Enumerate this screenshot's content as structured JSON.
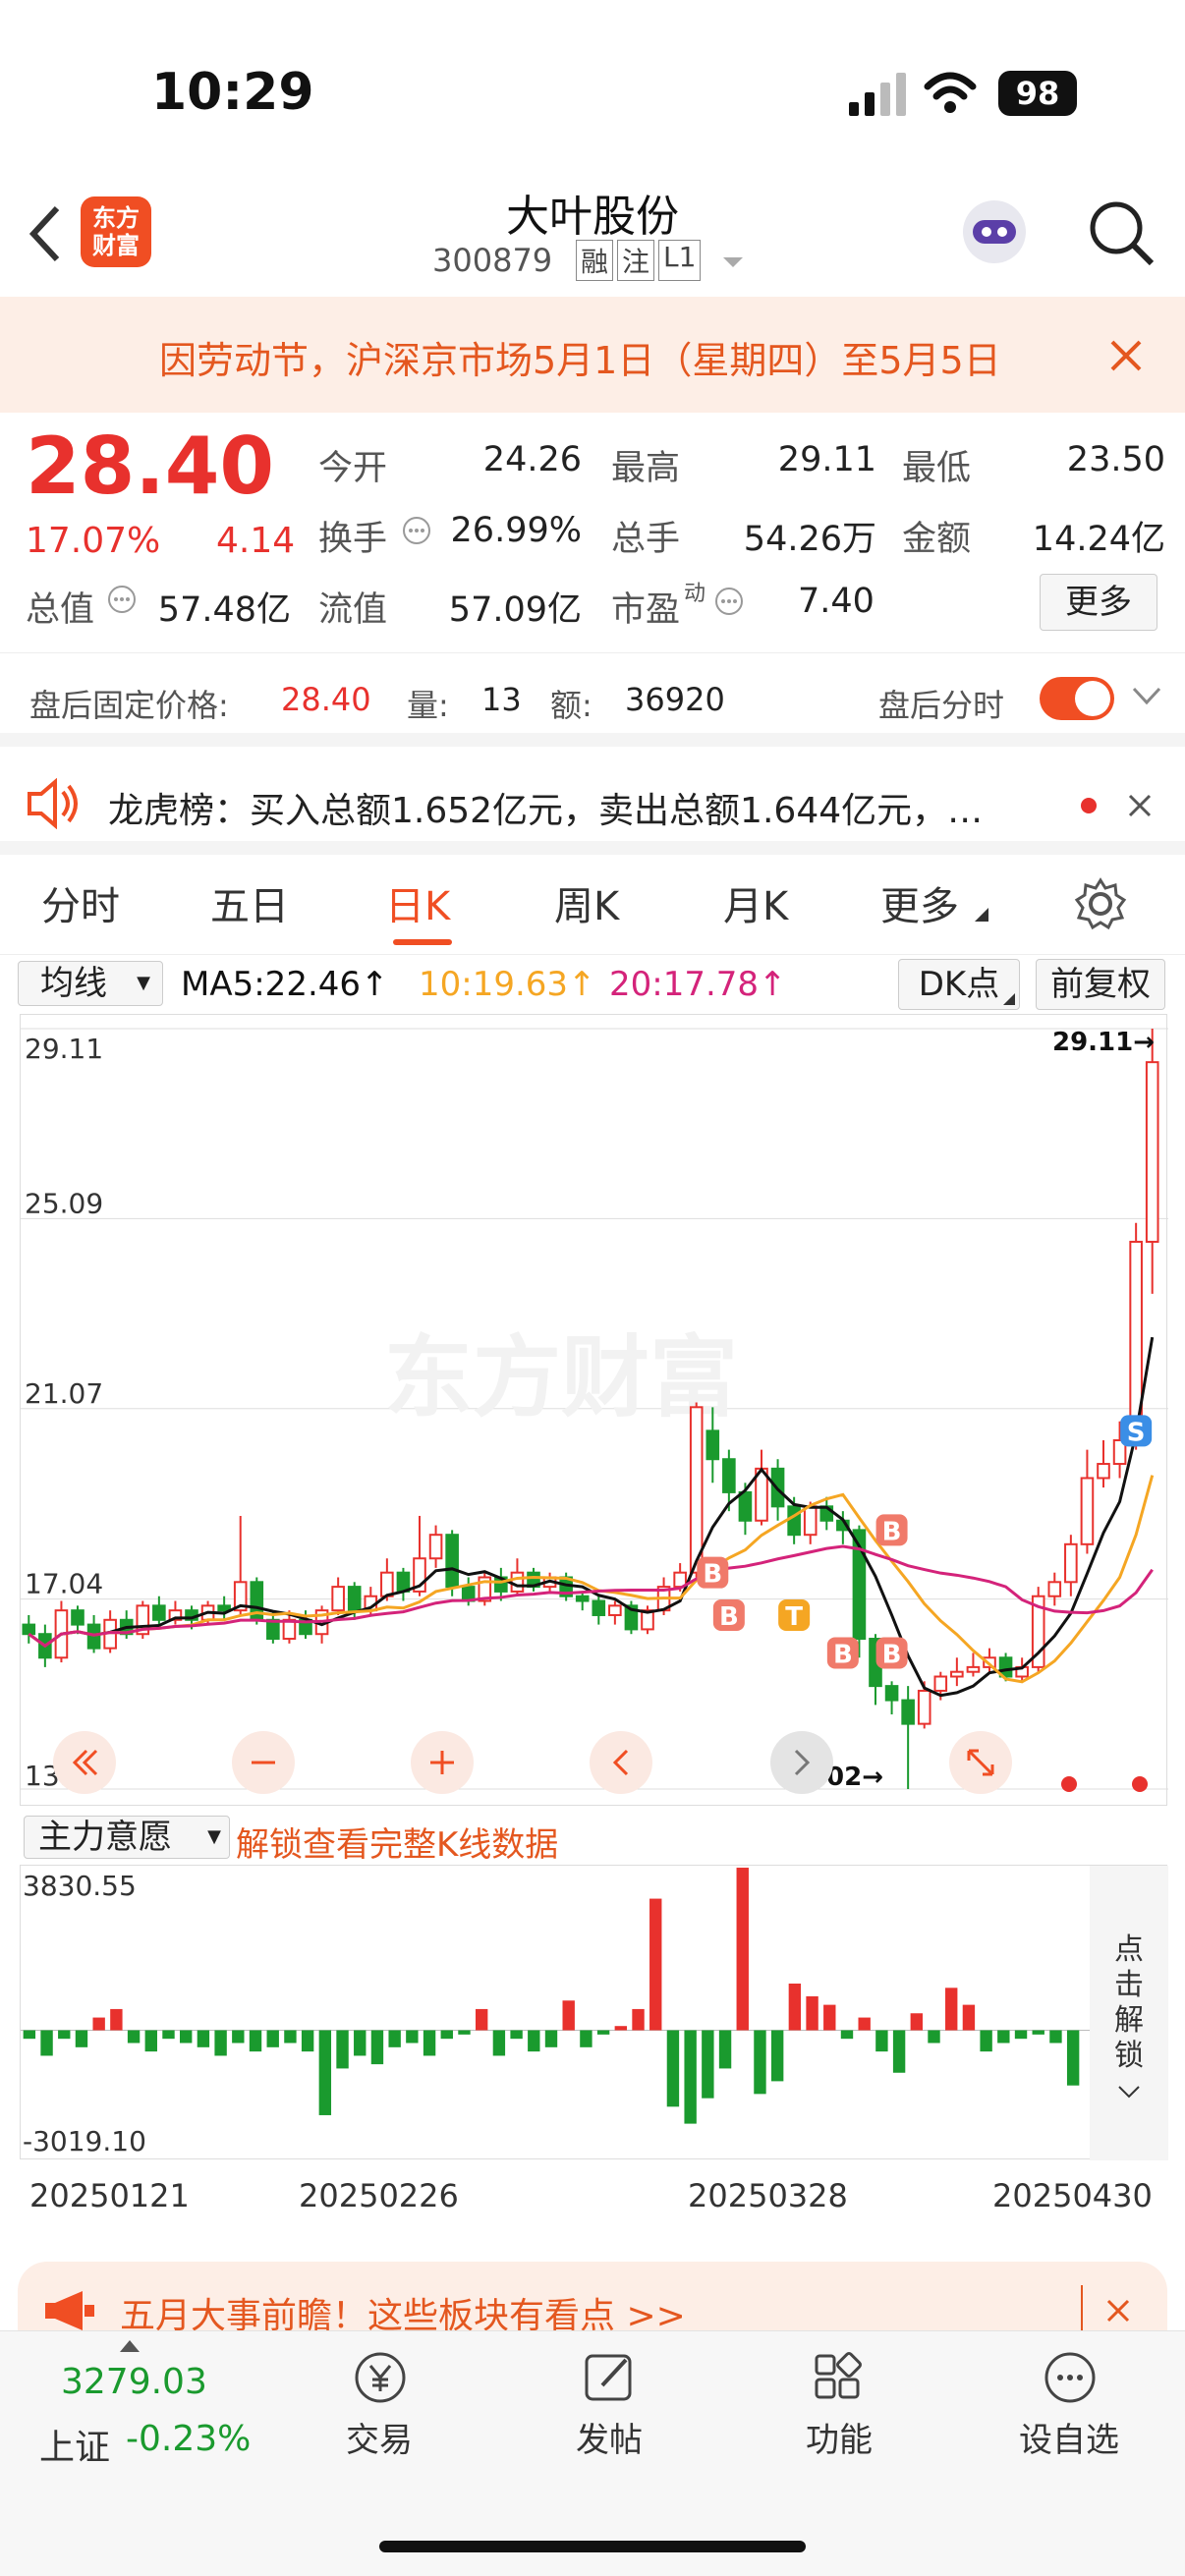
{
  "status": {
    "time": "10:29",
    "battery": "98"
  },
  "header": {
    "logo_line1": "东方",
    "logo_line2": "财富",
    "title": "大叶股份",
    "code": "300879",
    "tags": [
      "融",
      "注",
      "L1"
    ]
  },
  "notice": {
    "text": "因劳动节，沪深京市场5月1日（星期四）至5月5日"
  },
  "quote": {
    "price": "28.40",
    "change_pct": "17.07%",
    "change": "4.14",
    "fields": [
      {
        "label": "今开",
        "value": "24.26"
      },
      {
        "label": "最高",
        "value": "29.11"
      },
      {
        "label": "最低",
        "value": "23.50"
      },
      {
        "label": "换手",
        "value": "26.99%"
      },
      {
        "label": "总手",
        "value": "54.26万"
      },
      {
        "label": "金额",
        "value": "14.24亿"
      },
      {
        "label": "总值",
        "value": "57.48亿"
      },
      {
        "label": "流值",
        "value": "57.09亿"
      },
      {
        "label": "市盈",
        "value": "7.40"
      }
    ],
    "pe_sup": "动",
    "more": "更多"
  },
  "after_hours": {
    "label": "盘后固定价格:",
    "price": "28.40",
    "vol_label": "量:",
    "vol": "13",
    "amt_label": "额:",
    "amt": "36920",
    "toggle_label": "盘后分时"
  },
  "dragon": {
    "text": "龙虎榜：买入总额1.652亿元，卖出总额1.644亿元，…"
  },
  "tabs": [
    "分时",
    "五日",
    "日K",
    "周K",
    "月K",
    "更多"
  ],
  "ma": {
    "select": "均线",
    "ma5": "MA5:22.46↑",
    "ma10": "10:19.63↑",
    "ma20": "20:17.78↑",
    "dk": "DK点",
    "adjust": "前复权"
  },
  "chart_data": {
    "type": "candlestick",
    "y_ticks": [
      "29.11",
      "25.09",
      "21.07",
      "17.04",
      "13.02"
    ],
    "ylim": [
      13.02,
      29.11
    ],
    "high_marker": "29.11→",
    "low_marker": "13.02→",
    "candles": [
      [
        16.5,
        16.3,
        16.7,
        16.1
      ],
      [
        16.3,
        15.8,
        16.5,
        15.6
      ],
      [
        15.8,
        16.8,
        17.0,
        15.7
      ],
      [
        16.8,
        16.5,
        16.9,
        16.3
      ],
      [
        16.5,
        16.0,
        16.7,
        15.9
      ],
      [
        16.0,
        16.6,
        16.8,
        15.9
      ],
      [
        16.6,
        16.3,
        16.8,
        16.2
      ],
      [
        16.3,
        16.9,
        17.0,
        16.2
      ],
      [
        16.9,
        16.6,
        17.1,
        16.5
      ],
      [
        16.6,
        16.8,
        17.0,
        16.5
      ],
      [
        16.8,
        16.6,
        16.9,
        16.4
      ],
      [
        16.6,
        16.9,
        17.0,
        16.5
      ],
      [
        16.9,
        16.8,
        17.1,
        16.6
      ],
      [
        16.8,
        17.4,
        18.8,
        16.7
      ],
      [
        17.4,
        16.6,
        17.5,
        16.5
      ],
      [
        16.6,
        16.2,
        16.8,
        16.1
      ],
      [
        16.2,
        16.6,
        16.8,
        16.1
      ],
      [
        16.6,
        16.3,
        16.8,
        16.2
      ],
      [
        16.3,
        16.8,
        16.9,
        16.1
      ],
      [
        16.8,
        17.3,
        17.5,
        16.7
      ],
      [
        17.3,
        16.8,
        17.4,
        16.6
      ],
      [
        16.8,
        17.1,
        17.3,
        16.7
      ],
      [
        17.1,
        17.6,
        17.9,
        17.0
      ],
      [
        17.6,
        17.2,
        17.7,
        17.0
      ],
      [
        17.2,
        17.9,
        18.8,
        17.1
      ],
      [
        17.9,
        18.4,
        18.6,
        17.7
      ],
      [
        18.4,
        17.3,
        18.5,
        17.1
      ],
      [
        17.3,
        17.0,
        17.5,
        16.9
      ],
      [
        17.0,
        17.5,
        17.6,
        16.9
      ],
      [
        17.5,
        17.2,
        17.7,
        17.0
      ],
      [
        17.2,
        17.6,
        17.9,
        17.1
      ],
      [
        17.6,
        17.3,
        17.7,
        17.2
      ],
      [
        17.3,
        17.5,
        17.6,
        17.2
      ],
      [
        17.5,
        17.1,
        17.6,
        17.0
      ],
      [
        17.1,
        17.0,
        17.2,
        16.8
      ],
      [
        17.0,
        16.7,
        17.1,
        16.5
      ],
      [
        16.7,
        16.9,
        17.0,
        16.5
      ],
      [
        16.9,
        16.4,
        17.0,
        16.3
      ],
      [
        16.4,
        16.8,
        16.9,
        16.3
      ],
      [
        16.8,
        17.3,
        17.5,
        16.7
      ],
      [
        17.3,
        17.6,
        17.8,
        17.2
      ],
      [
        17.6,
        21.1,
        21.2,
        17.5
      ],
      [
        20.6,
        20.0,
        21.1,
        19.5
      ],
      [
        20.0,
        19.3,
        20.2,
        18.9
      ],
      [
        19.3,
        18.7,
        19.5,
        18.4
      ],
      [
        18.7,
        19.8,
        20.2,
        18.6
      ],
      [
        19.8,
        19.0,
        20.0,
        18.7
      ],
      [
        19.0,
        18.4,
        19.2,
        18.2
      ],
      [
        18.4,
        19.0,
        19.1,
        18.2
      ],
      [
        19.0,
        18.7,
        19.2,
        18.5
      ],
      [
        18.7,
        18.5,
        18.9,
        18.2
      ],
      [
        18.5,
        16.2,
        18.6,
        15.8
      ],
      [
        16.2,
        15.2,
        16.3,
        14.8
      ],
      [
        15.2,
        14.9,
        15.3,
        14.6
      ],
      [
        14.9,
        14.4,
        15.2,
        13.02
      ],
      [
        14.4,
        15.1,
        15.3,
        14.3
      ],
      [
        15.1,
        15.4,
        15.5,
        14.9
      ],
      [
        15.4,
        15.5,
        15.8,
        15.2
      ],
      [
        15.5,
        15.6,
        15.9,
        15.4
      ],
      [
        15.6,
        15.8,
        16.0,
        15.5
      ],
      [
        15.8,
        15.4,
        15.9,
        15.3
      ],
      [
        15.4,
        15.6,
        15.8,
        15.3
      ],
      [
        15.6,
        17.1,
        17.3,
        15.5
      ],
      [
        17.1,
        17.4,
        17.6,
        16.9
      ],
      [
        17.4,
        18.2,
        18.4,
        17.1
      ],
      [
        18.2,
        19.6,
        20.2,
        18.0
      ],
      [
        19.6,
        19.9,
        20.4,
        19.4
      ],
      [
        19.9,
        20.4,
        20.8,
        19.6
      ],
      [
        20.4,
        24.6,
        25.0,
        20.2
      ],
      [
        24.6,
        28.4,
        29.11,
        23.5
      ]
    ],
    "ma5_label": "MA5",
    "ma10_label": "10",
    "ma20_label": "20",
    "signals": [
      {
        "label": "B",
        "day": 42,
        "price": 17.6
      },
      {
        "label": "B",
        "day": 43,
        "price": 16.7
      },
      {
        "label": "T",
        "day": 47,
        "price": 16.7
      },
      {
        "label": "B",
        "day": 50,
        "price": 15.9
      },
      {
        "label": "B",
        "day": 53,
        "price": 15.9
      },
      {
        "label": "B",
        "day": 53,
        "price": 18.5
      },
      {
        "label": "S",
        "day": 68,
        "price": 20.6
      }
    ],
    "watermark": "东方财富",
    "colors": {
      "up": "#e8312d",
      "down": "#1a9a2e",
      "ma5": "#111111",
      "ma10": "#f5a623",
      "ma20": "#d4237a"
    }
  },
  "volume": {
    "select": "主力意愿",
    "unlock_text": "解锁查看完整K线数据",
    "max": "3830.55",
    "min": "-3019.10",
    "unlock_side": [
      "点",
      "击",
      "解",
      "锁"
    ],
    "bars": [
      -200,
      -600,
      -200,
      -400,
      300,
      500,
      -300,
      -500,
      -200,
      -300,
      -400,
      -600,
      -300,
      -500,
      -400,
      -300,
      -500,
      -2000,
      -900,
      -600,
      -800,
      -400,
      -300,
      -600,
      -200,
      -100,
      500,
      -600,
      -200,
      -500,
      -400,
      700,
      -400,
      -100,
      100,
      500,
      3100,
      -1800,
      -2200,
      -1600,
      -900,
      3830,
      -1500,
      -1200,
      1100,
      800,
      600,
      -200,
      300,
      -500,
      -1000,
      400,
      -300,
      1000,
      600,
      -500,
      -300,
      -200,
      -100,
      -300,
      -1300
    ],
    "colors": {
      "pos": "#e8312d",
      "neg": "#1a9a2e"
    }
  },
  "dates": [
    "20250121",
    "20250226",
    "20250328",
    "20250430"
  ],
  "promo": {
    "text": "五月大事前瞻！这些板块有看点 >>"
  },
  "bottom": {
    "index_value": "3279.03",
    "index_name": "上证",
    "index_change": "-0.23%",
    "nav": [
      {
        "label": "交易",
        "icon": "yen-icon"
      },
      {
        "label": "发帖",
        "icon": "edit-icon"
      },
      {
        "label": "功能",
        "icon": "grid-icon"
      },
      {
        "label": "设自选",
        "icon": "more-icon"
      }
    ]
  }
}
